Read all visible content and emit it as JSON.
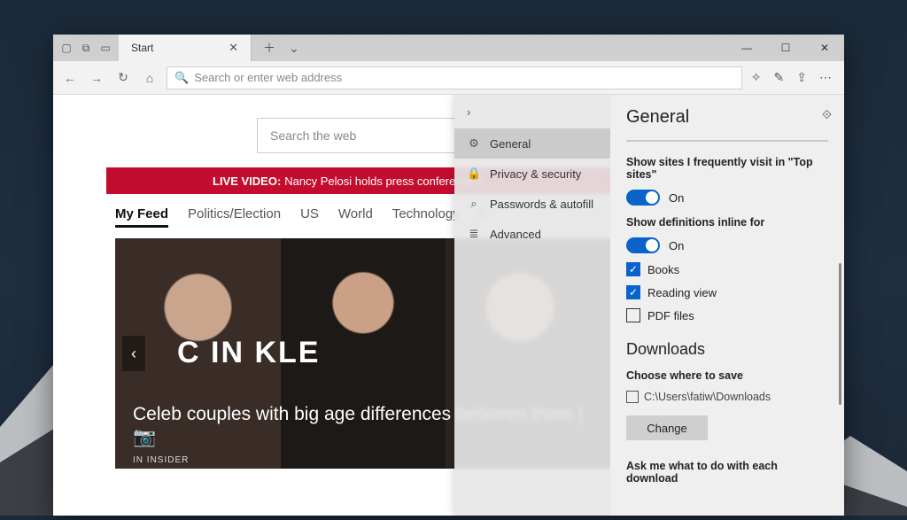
{
  "tab": {
    "title": "Start"
  },
  "toolbar": {
    "addr_placeholder": "Search or enter web address"
  },
  "page": {
    "search_placeholder": "Search the web",
    "banner_label": "LIVE VIDEO:",
    "banner_text": "Nancy Pelosi holds press conference o",
    "feed_tabs": [
      "My Feed",
      "Politics/Election",
      "US",
      "World",
      "Technology",
      "E"
    ],
    "hero_brand": "C    IN KLE",
    "hero_caption": "Celeb couples with big age differences between them | 📷",
    "hero_source": "IN   INSIDER"
  },
  "settings_nav": {
    "items": [
      {
        "icon": "gear",
        "label": "General"
      },
      {
        "icon": "lock",
        "label": "Privacy & security"
      },
      {
        "icon": "key",
        "label": "Passwords & autofill"
      },
      {
        "icon": "sliders",
        "label": "Advanced"
      }
    ]
  },
  "settings": {
    "title": "General",
    "topsite_label": "Show sites I frequently visit in \"Top sites\"",
    "topsite_state": "On",
    "defs_label": "Show definitions inline for",
    "defs_state": "On",
    "defs_opts": [
      "Books",
      "Reading view",
      "PDF files"
    ],
    "downloads_title": "Downloads",
    "choose_label": "Choose where to save",
    "save_path": "C:\\Users\\fatiw\\Downloads",
    "change_label": "Change",
    "ask_label": "Ask me what to do with each download"
  }
}
